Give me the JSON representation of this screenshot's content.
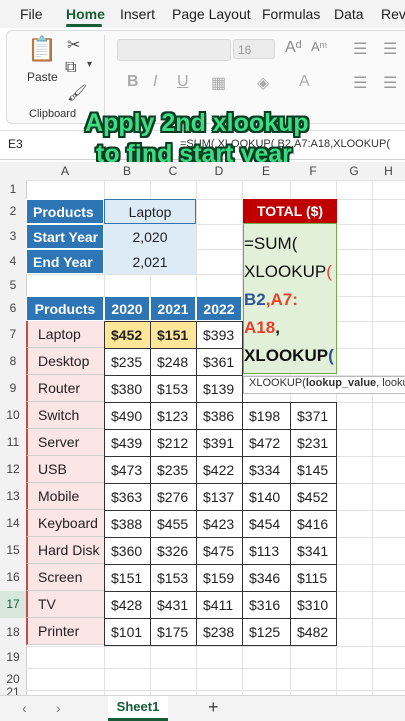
{
  "menu": {
    "tabs": [
      "File",
      "Home",
      "Insert",
      "Page Layout",
      "Formulas",
      "Data",
      "Revi"
    ],
    "active": "Home"
  },
  "ribbon": {
    "paste_label": "Paste",
    "clipboard_label": "Clipboard",
    "font_size": "16",
    "font_buttons": [
      "B",
      "I",
      "U"
    ]
  },
  "overlay": {
    "line1": "Apply 2nd xlookup",
    "line2": "to find start year"
  },
  "formula_bar": {
    "cell_ref": "E3",
    "text": "=SUM( XLOOKUP( B2,A7:A18,XLOOKUP("
  },
  "columns": [
    "A",
    "B",
    "C",
    "D",
    "E",
    "F",
    "G",
    "H"
  ],
  "rows": [
    "1",
    "2",
    "3",
    "4",
    "5",
    "6",
    "7",
    "8",
    "9",
    "10",
    "11",
    "12",
    "13",
    "14",
    "15",
    "16",
    "17",
    "18",
    "19",
    "20",
    "21"
  ],
  "lookup_table": {
    "labels": [
      "Products",
      "Start Year",
      "End Year"
    ],
    "values": [
      "Laptop",
      "2,020",
      "2,021"
    ]
  },
  "total": {
    "header": "TOTAL ($)",
    "formula_lines": {
      "l1": "=SUM(",
      "l2a": "XLOOKUP",
      "l2b": "(",
      "l3a": "B2",
      "l3b": ",A7:",
      "l4a": "A18",
      "l4b": ",",
      "l5a": "XLOOKUP",
      "l5b": "("
    }
  },
  "tooltip": {
    "fn": "XLOOKUP(",
    "arg": "lookup_value",
    "rest": ", looku"
  },
  "data_table": {
    "headers": [
      "Products",
      "2020",
      "2021",
      "2022"
    ],
    "rows": [
      {
        "p": "Laptop",
        "v": [
          "$452",
          "$151",
          "$393"
        ],
        "e": [
          "",
          ""
        ]
      },
      {
        "p": "Desktop",
        "v": [
          "$235",
          "$248",
          "$361"
        ],
        "e": [
          "",
          ""
        ]
      },
      {
        "p": "Router",
        "v": [
          "$380",
          "$153",
          "$139"
        ],
        "e": [
          "",
          ""
        ]
      },
      {
        "p": "Switch",
        "v": [
          "$490",
          "$123",
          "$386"
        ],
        "e": [
          "$198",
          "$371"
        ]
      },
      {
        "p": "Server",
        "v": [
          "$439",
          "$212",
          "$391"
        ],
        "e": [
          "$472",
          "$231"
        ]
      },
      {
        "p": "USB",
        "v": [
          "$473",
          "$235",
          "$422"
        ],
        "e": [
          "$334",
          "$145"
        ]
      },
      {
        "p": "Mobile",
        "v": [
          "$363",
          "$276",
          "$137"
        ],
        "e": [
          "$140",
          "$452"
        ]
      },
      {
        "p": "Keyboard",
        "v": [
          "$388",
          "$455",
          "$423"
        ],
        "e": [
          "$454",
          "$416"
        ]
      },
      {
        "p": "Hard Disk",
        "v": [
          "$360",
          "$326",
          "$475"
        ],
        "e": [
          "$113",
          "$341"
        ]
      },
      {
        "p": "Screen",
        "v": [
          "$151",
          "$153",
          "$159"
        ],
        "e": [
          "$346",
          "$115"
        ]
      },
      {
        "p": "TV",
        "v": [
          "$428",
          "$431",
          "$411"
        ],
        "e": [
          "$316",
          "$310"
        ]
      },
      {
        "p": "Printer",
        "v": [
          "$101",
          "$175",
          "$238"
        ],
        "e": [
          "$125",
          "$482"
        ]
      }
    ]
  },
  "sheets": {
    "active": "Sheet1",
    "add_label": "+"
  }
}
